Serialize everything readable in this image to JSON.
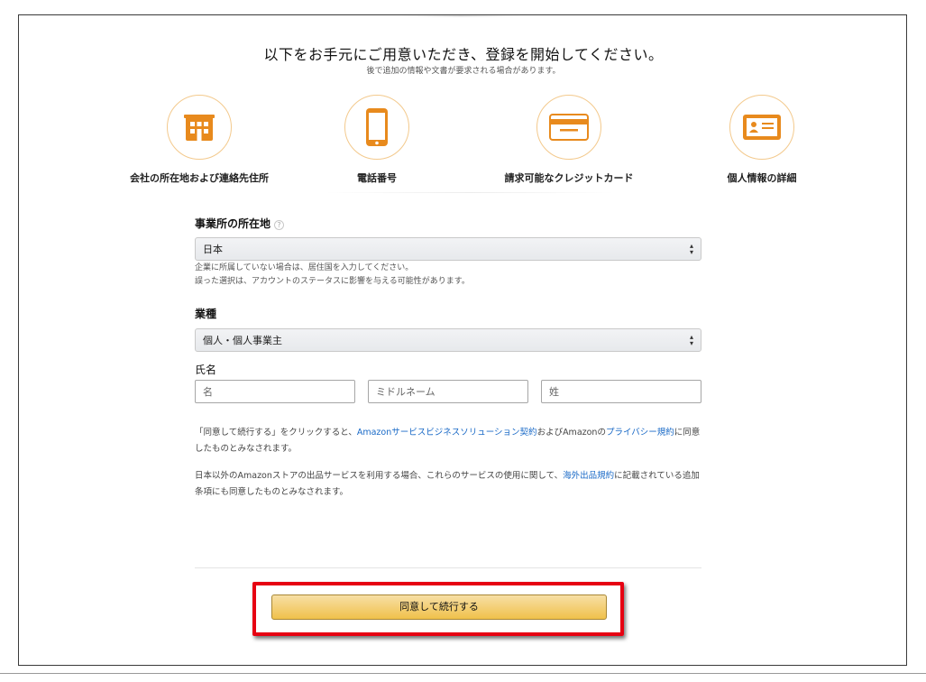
{
  "header": {
    "title": "以下をお手元にご用意いただき、登録を開始してください。",
    "subtitle": "後で追加の情報や文書が要求される場合があります。"
  },
  "steps": [
    {
      "label": "会社の所在地および連絡先住所",
      "icon": "building-icon"
    },
    {
      "label": "電話番号",
      "icon": "phone-icon"
    },
    {
      "label": "請求可能なクレジットカード",
      "icon": "credit-card-icon"
    },
    {
      "label": "個人情報の詳細",
      "icon": "id-card-icon"
    }
  ],
  "form": {
    "location": {
      "label": "事業所の所在地",
      "value": "日本",
      "hint1": "企業に所属していない場合は、居住国を入力してください。",
      "hint2": "誤った選択は、アカウントのステータスに影響を与える可能性があります。"
    },
    "business_type": {
      "label": "業種",
      "value": "個人・個人事業主"
    },
    "name": {
      "label": "氏名",
      "first_placeholder": "名",
      "middle_placeholder": "ミドルネーム",
      "last_placeholder": "姓"
    }
  },
  "legal": {
    "p1_prefix": "「同意して続行する」をクリックすると、",
    "p1_link1": "Amazonサービスビジネスソリューション契約",
    "p1_mid": "およびAmazonの",
    "p1_link2": "プライバシー規約",
    "p1_suffix": "に同意したものとみなされます。",
    "p2_prefix": "日本以外のAmazonストアの出品サービスを利用する場合、これらのサービスの使用に関して、",
    "p2_link": "海外出品規約",
    "p2_suffix": "に記載されている追加条項にも同意したものとみなされます。"
  },
  "actions": {
    "continue_label": "同意して続行する"
  },
  "colors": {
    "icon_orange": "#e88a1d",
    "highlight_red": "#e60012",
    "button_gold": "#f0c14b",
    "link_blue": "#1a6ac7"
  }
}
